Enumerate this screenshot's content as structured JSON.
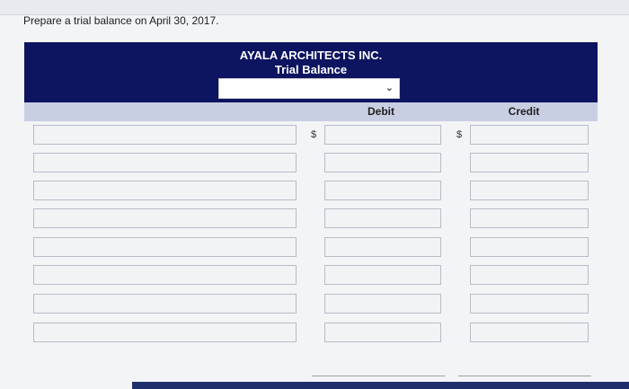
{
  "prompt": "Prepare a trial balance on April 30, 2017.",
  "statement": {
    "company": "AYALA ARCHITECTS INC.",
    "report": "Trial Balance",
    "date_select_value": ""
  },
  "columns": {
    "debit": "Debit",
    "credit": "Credit"
  },
  "currency_symbol": "$",
  "rows": [
    {
      "account": "",
      "debit": "",
      "credit": ""
    },
    {
      "account": "",
      "debit": "",
      "credit": ""
    },
    {
      "account": "",
      "debit": "",
      "credit": ""
    },
    {
      "account": "",
      "debit": "",
      "credit": ""
    },
    {
      "account": "",
      "debit": "",
      "credit": ""
    },
    {
      "account": "",
      "debit": "",
      "credit": ""
    },
    {
      "account": "",
      "debit": "",
      "credit": ""
    },
    {
      "account": "",
      "debit": "",
      "credit": ""
    }
  ],
  "colors": {
    "header_band": "#0d1460",
    "column_header": "#c9cfe3"
  }
}
